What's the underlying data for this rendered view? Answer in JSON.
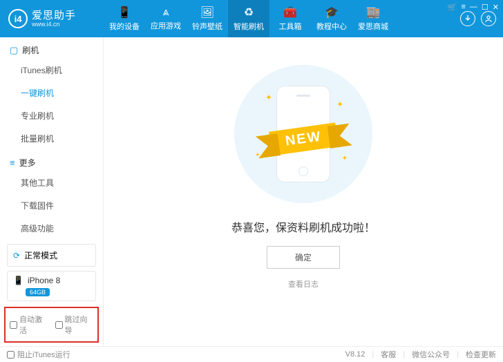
{
  "brand": {
    "name": "爱思助手",
    "url": "www.i4.cn",
    "logo_text": "i4"
  },
  "nav": [
    {
      "label": "我的设备"
    },
    {
      "label": "应用游戏"
    },
    {
      "label": "铃声壁纸"
    },
    {
      "label": "智能刷机",
      "active": true
    },
    {
      "label": "工具箱"
    },
    {
      "label": "教程中心"
    },
    {
      "label": "爱思商城"
    }
  ],
  "sidebar": {
    "sections": [
      {
        "title": "刷机",
        "items": [
          {
            "label": "iTunes刷机"
          },
          {
            "label": "一键刷机",
            "active": true
          },
          {
            "label": "专业刷机"
          },
          {
            "label": "批量刷机"
          }
        ]
      },
      {
        "title": "更多",
        "items": [
          {
            "label": "其他工具"
          },
          {
            "label": "下载固件"
          },
          {
            "label": "高级功能"
          }
        ]
      }
    ],
    "mode": "正常模式",
    "device": {
      "name": "iPhone 8",
      "storage": "64GB"
    },
    "checks": {
      "auto_activate": "自动激活",
      "skip_guide": "跳过向导"
    }
  },
  "main": {
    "ribbon": "NEW",
    "success": "恭喜您，保资料刷机成功啦！",
    "ok": "确定",
    "view_log": "查看日志"
  },
  "footer": {
    "block_itunes": "阻止iTunes运行",
    "version": "V8.12",
    "support": "客服",
    "wechat": "微信公众号",
    "check_update": "检查更新"
  }
}
